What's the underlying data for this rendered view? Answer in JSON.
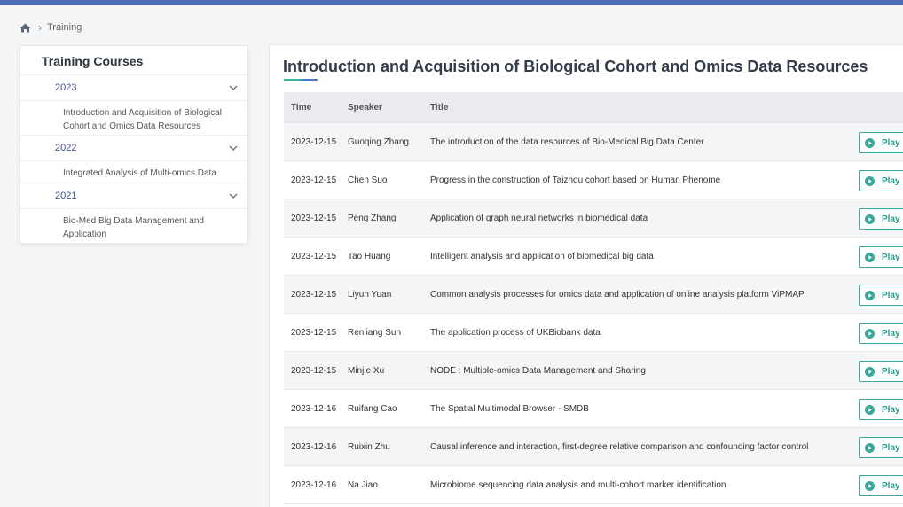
{
  "breadcrumb": {
    "home_icon": "home-icon",
    "separator": "›",
    "current": "Training"
  },
  "sidebar": {
    "title": "Training Courses",
    "groups": [
      {
        "year": "2023",
        "courses": [
          "Introduction and Acquisition of Biological Cohort and Omics Data Resources"
        ]
      },
      {
        "year": "2022",
        "courses": [
          "Integrated Analysis of Multi-omics Data"
        ]
      },
      {
        "year": "2021",
        "courses": [
          "Bio-Med Big Data Management and Application"
        ]
      }
    ]
  },
  "main": {
    "title": "Introduction and Acquisition of Biological Cohort and Omics Data Resources",
    "columns": {
      "time": "Time",
      "speaker": "Speaker",
      "title": "Title"
    },
    "play_label": "Play",
    "rows": [
      {
        "time": "2023-12-15",
        "speaker": "Guoqing Zhang",
        "title": "The introduction of the data resources of Bio-Medical Big Data Center"
      },
      {
        "time": "2023-12-15",
        "speaker": "Chen Suo",
        "title": "Progress in the construction of Taizhou cohort based on Human Phenome"
      },
      {
        "time": "2023-12-15",
        "speaker": "Peng Zhang",
        "title": "Application of graph neural networks in biomedical data"
      },
      {
        "time": "2023-12-15",
        "speaker": "Tao Huang",
        "title": "Intelligent analysis and application of biomedical big data"
      },
      {
        "time": "2023-12-15",
        "speaker": "Liyun Yuan",
        "title": "Common analysis processes for omics data and application of online analysis platform ViPMAP"
      },
      {
        "time": "2023-12-15",
        "speaker": "Renliang Sun",
        "title": "The application process of UKBiobank data"
      },
      {
        "time": "2023-12-15",
        "speaker": "Minjie Xu",
        "title": "NODE : Multiple-omics Data Management and Sharing"
      },
      {
        "time": "2023-12-16",
        "speaker": "Ruifang Cao",
        "title": "The Spatial Multimodal Browser - SMDB"
      },
      {
        "time": "2023-12-16",
        "speaker": "Ruixin Zhu",
        "title": "Causal inference and interaction, first-degree relative comparison and confounding factor control"
      },
      {
        "time": "2023-12-16",
        "speaker": "Na Jiao",
        "title": "Microbiome sequencing data analysis and multi-cohort marker identification"
      }
    ]
  },
  "colors": {
    "topbar": "#4a6cb7",
    "accent_teal": "#39a89a",
    "year_text": "#3f4f8a"
  }
}
